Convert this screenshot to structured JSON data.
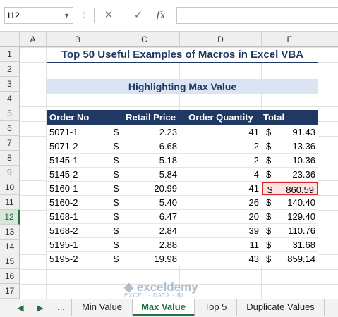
{
  "formula_bar": {
    "name_box": "I12",
    "cancel_icon": "✕",
    "enter_icon": "✓",
    "fx_label": "fx",
    "formula": ""
  },
  "columns": [
    "A",
    "B",
    "C",
    "D",
    "E"
  ],
  "rows": [
    "1",
    "2",
    "3",
    "4",
    "5",
    "6",
    "7",
    "8",
    "9",
    "10",
    "11",
    "12",
    "13",
    "14",
    "15",
    "16",
    "17"
  ],
  "sheet": {
    "title": "Top 50 Useful Examples of Macros in Excel VBA",
    "subtitle": "Highlighting Max Value",
    "headers": [
      "Order No",
      "Retail Price",
      "Order Quantity",
      "Total"
    ],
    "currency_symbol": "$",
    "data": [
      {
        "order": "5071-1",
        "price": "2.23",
        "qty": "41",
        "total": "91.43"
      },
      {
        "order": "5071-2",
        "price": "6.68",
        "qty": "2",
        "total": "13.36"
      },
      {
        "order": "5145-1",
        "price": "5.18",
        "qty": "2",
        "total": "10.36"
      },
      {
        "order": "5145-2",
        "price": "5.84",
        "qty": "4",
        "total": "23.36"
      },
      {
        "order": "5160-1",
        "price": "20.99",
        "qty": "41",
        "total": "860.59"
      },
      {
        "order": "5160-2",
        "price": "5.40",
        "qty": "26",
        "total": "140.40"
      },
      {
        "order": "5168-1",
        "price": "6.47",
        "qty": "20",
        "total": "129.40"
      },
      {
        "order": "5168-2",
        "price": "2.84",
        "qty": "39",
        "total": "110.76"
      },
      {
        "order": "5195-1",
        "price": "2.88",
        "qty": "11",
        "total": "31.68"
      },
      {
        "order": "5195-2",
        "price": "19.98",
        "qty": "43",
        "total": "859.14"
      }
    ]
  },
  "tabs": {
    "more": "...",
    "items": [
      "Min Value",
      "Max Value",
      "Top 5",
      "Duplicate Values"
    ],
    "active": "Max Value"
  },
  "watermark": {
    "name": "exceldemy",
    "tagline": "EXCEL · DATA · BI"
  },
  "colors": {
    "header_bg": "#1f3864",
    "subtitle_bg": "#dbe4f3",
    "highlight": "#e0292b",
    "accent": "#217346"
  }
}
